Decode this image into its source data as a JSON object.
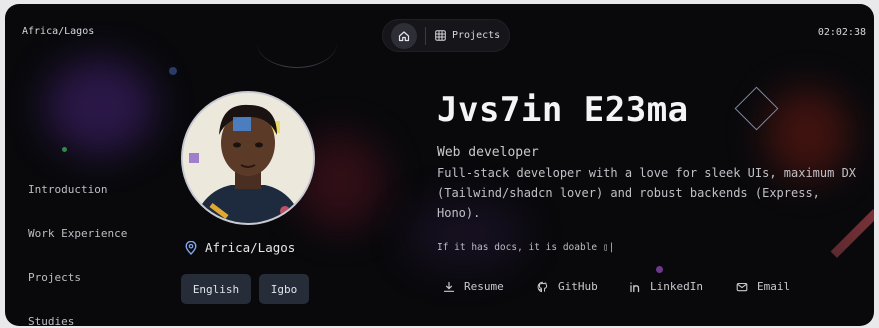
{
  "header": {
    "location": "Africa/Lagos",
    "time": "02:02:38",
    "nav": {
      "home_icon": "home-icon",
      "projects_label": "Projects"
    }
  },
  "sidebar": {
    "items": [
      {
        "label": "Introduction"
      },
      {
        "label": "Work Experience"
      },
      {
        "label": "Projects"
      },
      {
        "label": "Studies"
      }
    ]
  },
  "profile": {
    "location": "Africa/Lagos",
    "languages": [
      "English",
      "Igbo"
    ]
  },
  "hero": {
    "name": "Jvs7in E23ma",
    "role": "Web developer",
    "bio": "Full-stack developer with a love for sleek UIs, maximum DX (Tailwind/shadcn lover) and robust backends (Express, Hono).",
    "tagline": "If it has docs, it is doable ▯|"
  },
  "links": [
    {
      "label": "Resume",
      "icon": "download-icon"
    },
    {
      "label": "GitHub",
      "icon": "github-icon"
    },
    {
      "label": "LinkedIn",
      "icon": "linkedin-icon"
    },
    {
      "label": "Email",
      "icon": "mail-icon"
    }
  ]
}
